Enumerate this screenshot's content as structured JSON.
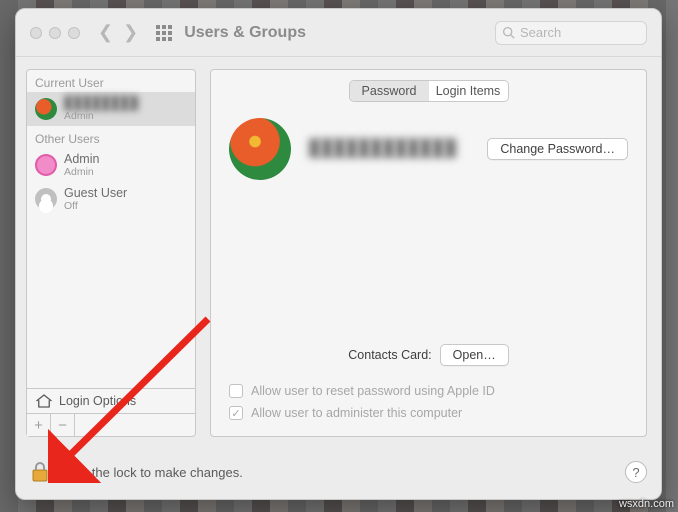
{
  "toolbar": {
    "title": "Users & Groups",
    "search_placeholder": "Search"
  },
  "sidebar": {
    "section_current": "Current User",
    "section_other": "Other Users",
    "current": {
      "name": "████████",
      "role": "Admin"
    },
    "others": [
      {
        "name": "Admin",
        "role": "Admin"
      },
      {
        "name": "Guest User",
        "role": "Off"
      }
    ],
    "login_options": "Login Options",
    "plus": "+",
    "minus": "−"
  },
  "main": {
    "tabs": {
      "password": "Password",
      "login_items": "Login Items"
    },
    "username_display": "████████████",
    "change_password": "Change Password…",
    "contacts_label": "Contacts Card:",
    "open_btn": "Open…",
    "allow_reset": "Allow user to reset password using Apple ID",
    "allow_admin": "Allow user to administer this computer"
  },
  "footer": {
    "lock_text": "Click the lock to make changes.",
    "help": "?"
  },
  "watermark": "wsxdn.com"
}
